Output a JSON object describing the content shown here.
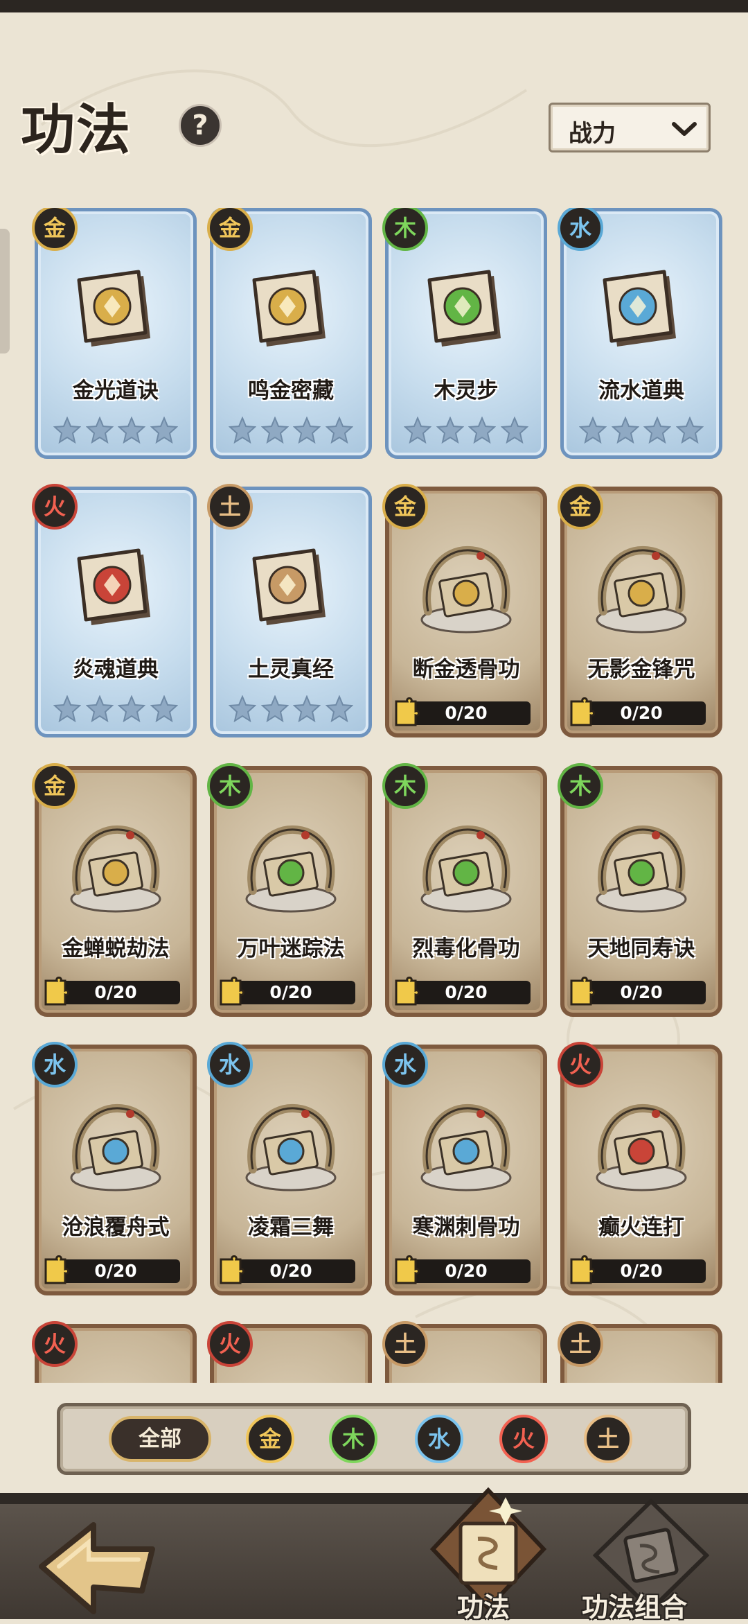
{
  "header": {
    "title": "功法",
    "help_symbol": "?",
    "sort_label": "战力"
  },
  "cards": [
    {
      "name": "金光道诀",
      "element": "金",
      "style": "blue",
      "icon": "golden-light-book-icon"
    },
    {
      "name": "鸣金密藏",
      "element": "金",
      "style": "blue",
      "icon": "golden-shield-book-icon"
    },
    {
      "name": "木灵步",
      "element": "木",
      "style": "blue",
      "icon": "leaf-book-icon"
    },
    {
      "name": "流水道典",
      "element": "水",
      "style": "blue",
      "icon": "wave-book-icon"
    },
    {
      "name": "炎魂道典",
      "element": "火",
      "style": "blue",
      "icon": "flame-book-icon"
    },
    {
      "name": "土灵真经",
      "element": "土",
      "style": "blue",
      "icon": "rock-book-icon"
    },
    {
      "name": "断金透骨功",
      "element": "金",
      "style": "brown",
      "progress": "0/20",
      "icon": "dragon-scroll-icon"
    },
    {
      "name": "无影金锋咒",
      "element": "金",
      "style": "brown",
      "progress": "0/20",
      "icon": "dragon-scroll-icon"
    },
    {
      "name": "金蝉蜕劫法",
      "element": "金",
      "style": "brown",
      "progress": "0/20",
      "icon": "dragon-scroll-icon"
    },
    {
      "name": "万叶迷踪法",
      "element": "木",
      "style": "brown",
      "progress": "0/20",
      "icon": "dragon-scroll-icon"
    },
    {
      "name": "烈毒化骨功",
      "element": "木",
      "style": "brown",
      "progress": "0/20",
      "icon": "dragon-scroll-icon"
    },
    {
      "name": "天地同寿诀",
      "element": "木",
      "style": "brown",
      "progress": "0/20",
      "icon": "dragon-scroll-icon"
    },
    {
      "name": "沧浪覆舟式",
      "element": "水",
      "style": "brown",
      "progress": "0/20",
      "icon": "dragon-scroll-icon"
    },
    {
      "name": "凌霜三舞",
      "element": "水",
      "style": "brown",
      "progress": "0/20",
      "icon": "dragon-scroll-icon"
    },
    {
      "name": "寒渊刺骨功",
      "element": "水",
      "style": "brown",
      "progress": "0/20",
      "icon": "dragon-scroll-icon"
    },
    {
      "name": "癫火连打",
      "element": "火",
      "style": "brown",
      "progress": "0/20",
      "icon": "dragon-scroll-icon"
    },
    {
      "name": "",
      "element": "火",
      "style": "brown",
      "icon": "dragon-scroll-icon"
    },
    {
      "name": "",
      "element": "火",
      "style": "brown",
      "icon": "dragon-scroll-icon"
    },
    {
      "name": "",
      "element": "土",
      "style": "brown",
      "icon": "dragon-scroll-icon"
    },
    {
      "name": "",
      "element": "土",
      "style": "brown",
      "icon": "dragon-scroll-icon"
    }
  ],
  "filter": {
    "all_label": "全部",
    "elements": [
      "金",
      "木",
      "水",
      "火",
      "土"
    ]
  },
  "nav": {
    "tab1_label": "功法",
    "tab2_label": "功法组合"
  },
  "colors": {
    "金": "#d9ae4a",
    "木": "#62b545",
    "水": "#5aa9d6",
    "火": "#c94438",
    "土": "#c79a66"
  }
}
